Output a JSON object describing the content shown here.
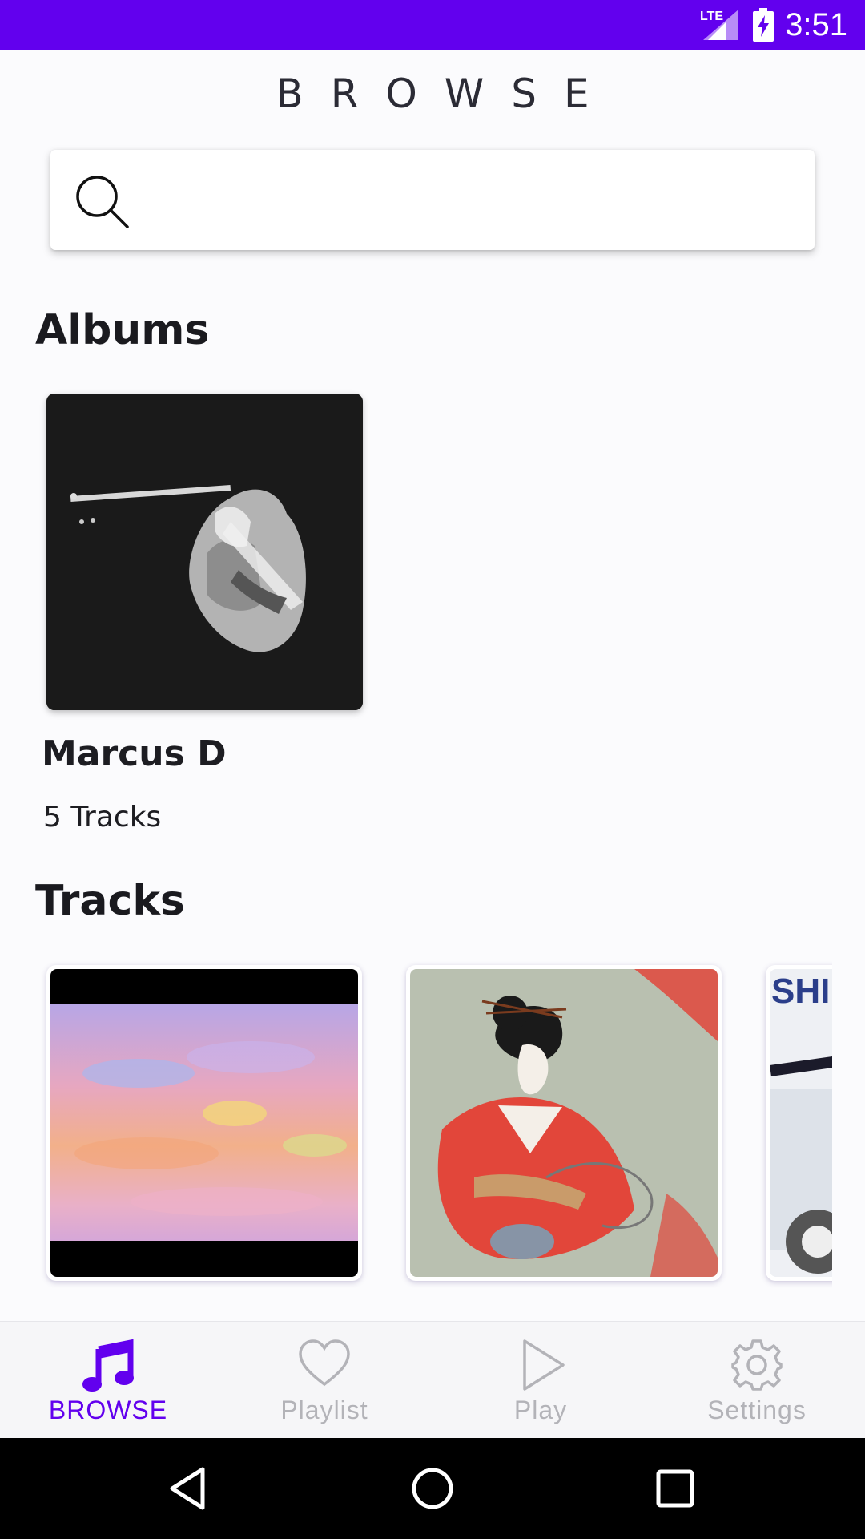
{
  "status_bar": {
    "network": "LTE",
    "time": "3:51",
    "background_color": "#6200ee"
  },
  "header": {
    "title": "BROWSE"
  },
  "search": {
    "value": "",
    "placeholder": "",
    "icon": "search-icon"
  },
  "albums": {
    "heading": "Albums",
    "items": [
      {
        "name": "Marcus D",
        "tracks_label": "5 Tracks",
        "art": "guitarist-black-white-photo"
      }
    ]
  },
  "tracks": {
    "heading": "Tracks",
    "items": [
      {
        "art": "pastel-abstract-painting"
      },
      {
        "art": "geisha-illustration-red-kimono"
      },
      {
        "art": "partially-visible-cover"
      }
    ]
  },
  "bottom_nav": {
    "active_color": "#6200ee",
    "inactive_color": "#b3b3b8",
    "items": [
      {
        "label": "BROWSE",
        "icon": "music-note-icon",
        "active": true
      },
      {
        "label": "Playlist",
        "icon": "heart-icon",
        "active": false
      },
      {
        "label": "Play",
        "icon": "play-icon",
        "active": false
      },
      {
        "label": "Settings",
        "icon": "gear-icon",
        "active": false
      }
    ]
  },
  "system_nav": {
    "buttons": [
      "back-icon",
      "home-icon",
      "recents-icon"
    ]
  }
}
